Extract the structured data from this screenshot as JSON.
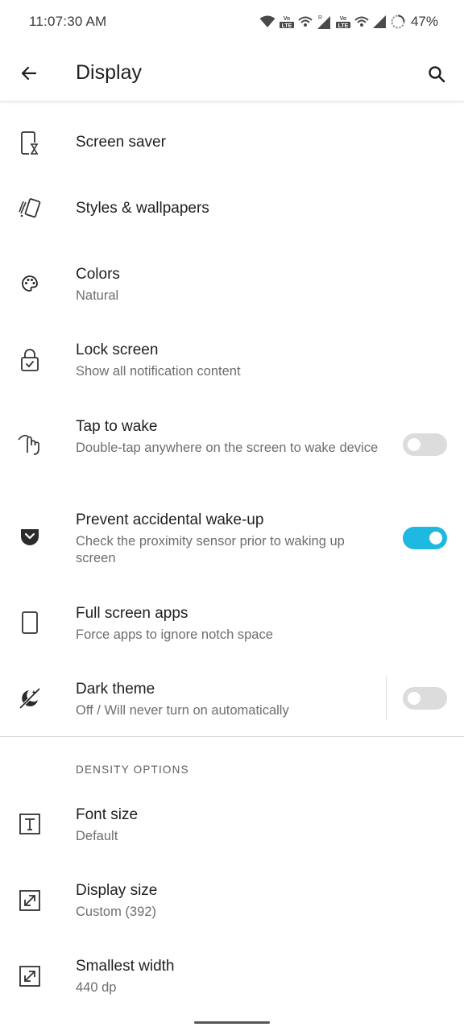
{
  "status_bar": {
    "time": "11:07:30 AM",
    "battery": "47%",
    "icons": [
      "wifi-icon",
      "volte-icon",
      "hotspot-icon",
      "signal-icon",
      "volte-icon",
      "hotspot-icon",
      "signal-icon",
      "battery-icon"
    ],
    "roaming_indicator": "R",
    "volte_text": "Vo\nLTE"
  },
  "app_bar": {
    "title": "Display",
    "back_icon": "arrow-back-icon",
    "search_icon": "search-icon"
  },
  "settings": [
    {
      "title": "Screen saver",
      "summary": "",
      "icon": "screen-saver-icon"
    },
    {
      "title": "Styles & wallpapers",
      "summary": "",
      "icon": "styles-icon"
    },
    {
      "title": "Colors",
      "summary": "Natural",
      "icon": "palette-icon"
    },
    {
      "title": "Lock screen",
      "summary": "Show all notification content",
      "icon": "lock-icon"
    },
    {
      "title": "Tap to wake",
      "summary": "Double-tap anywhere on the screen to wake device",
      "icon": "tap-icon",
      "toggle": "off"
    },
    {
      "title": "Prevent accidental wake-up",
      "summary": "Check the proximity sensor prior to waking up screen",
      "icon": "pocket-icon",
      "toggle": "on"
    },
    {
      "title": "Full screen apps",
      "summary": "Force apps to ignore notch space",
      "icon": "phone-outline-icon"
    },
    {
      "title": "Dark theme",
      "summary": "Off / Will never turn on automatically",
      "icon": "dark-theme-icon",
      "toggle": "off"
    }
  ],
  "density_section": {
    "header": "DENSITY OPTIONS",
    "items": [
      {
        "title": "Font size",
        "summary": "Default",
        "icon": "font-size-icon"
      },
      {
        "title": "Display size",
        "summary": "Custom (392)",
        "icon": "resize-icon"
      },
      {
        "title": "Smallest width",
        "summary": "440 dp",
        "icon": "resize-icon"
      }
    ]
  },
  "colors": {
    "accent": "#1fb8e0",
    "toggle_off": "#dcdcdc",
    "text_primary": "#1f1f1f",
    "text_secondary": "#6e6e6e"
  }
}
